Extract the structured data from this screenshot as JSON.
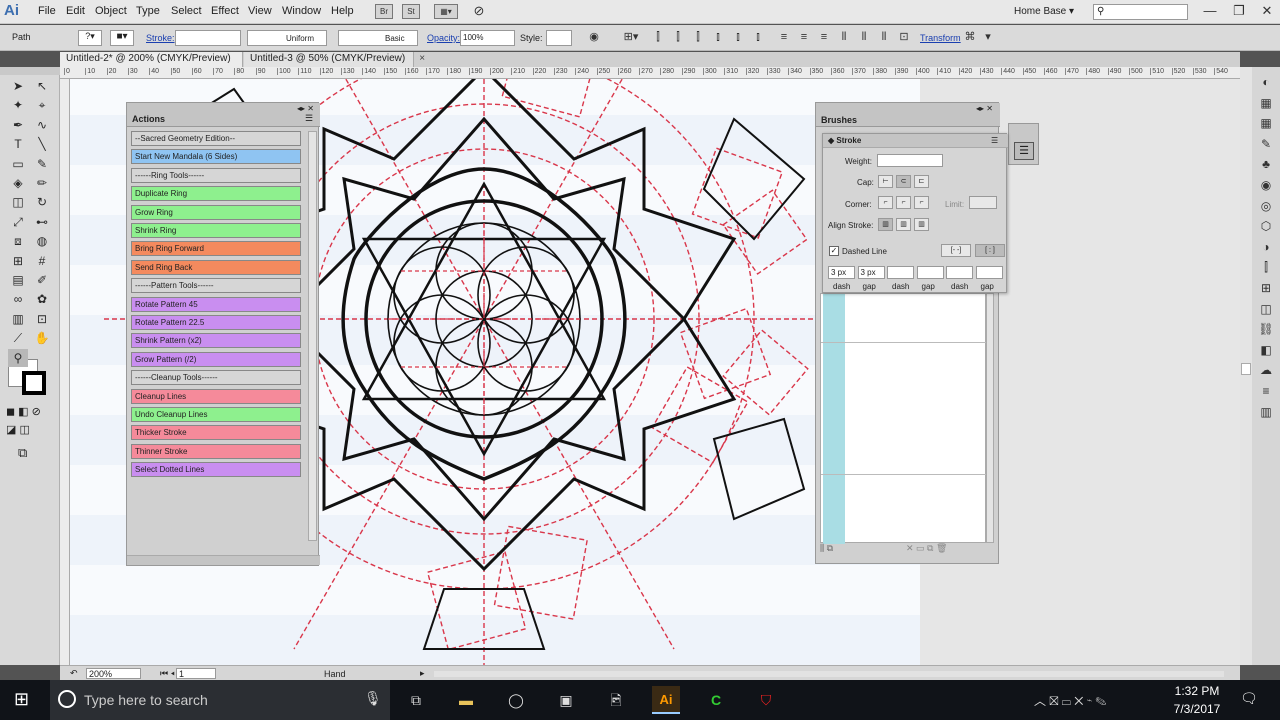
{
  "app": {
    "logo": "Ai",
    "workspace": "Home Base",
    "search_placeholder": ""
  },
  "menu": [
    "File",
    "Edit",
    "Object",
    "Type",
    "Select",
    "Effect",
    "View",
    "Window",
    "Help"
  ],
  "control": {
    "selection": "Path",
    "stroke_label": "Stroke:",
    "profile": "Uniform",
    "brush": "Basic",
    "opacity_label": "Opacity:",
    "opacity": "100%",
    "style_label": "Style:",
    "transform": "Transform"
  },
  "tabs": [
    {
      "label": "Untitled-2* @ 200% (CMYK/Preview)",
      "close": "×"
    },
    {
      "label": "Untitled-3 @ 50% (CMYK/Preview)",
      "close": "×"
    }
  ],
  "ruler_ticks": [
    "0",
    "10",
    "20",
    "30",
    "40",
    "50",
    "60",
    "70",
    "80",
    "90",
    "100",
    "110",
    "120",
    "130",
    "140",
    "150",
    "160",
    "170",
    "180",
    "190",
    "200",
    "210",
    "220",
    "230",
    "240",
    "250",
    "260",
    "270",
    "280",
    "290",
    "300",
    "310",
    "320",
    "330",
    "340",
    "350",
    "360",
    "370",
    "380",
    "390",
    "400",
    "410",
    "420",
    "430",
    "440",
    "450",
    "460",
    "470",
    "480",
    "490",
    "500",
    "510",
    "520",
    "530",
    "540"
  ],
  "actions_panel": {
    "title": "Actions",
    "items": [
      {
        "label": "--Sacred Geometry Edition--",
        "color": "#d6d6d6"
      },
      {
        "label": "Start New Mandala (6 Sides)",
        "color": "#8fc4f2"
      },
      {
        "label": "------Ring Tools------",
        "color": "#d6d6d6"
      },
      {
        "label": "Duplicate Ring",
        "color": "#8ef08e"
      },
      {
        "label": "Grow Ring",
        "color": "#8ef08e"
      },
      {
        "label": "Shrink Ring",
        "color": "#8ef08e"
      },
      {
        "label": "Bring Ring Forward",
        "color": "#f48a5e"
      },
      {
        "label": "Send Ring Back",
        "color": "#f48a5e"
      },
      {
        "label": "------Pattern Tools------",
        "color": "#d6d6d6"
      },
      {
        "label": "Rotate Pattern 45",
        "color": "#c98ef0"
      },
      {
        "label": "Rotate Pattern 22.5",
        "color": "#c98ef0"
      },
      {
        "label": "Shrink Pattern (x2)",
        "color": "#c98ef0"
      },
      {
        "label": "Grow Pattern (/2)",
        "color": "#c98ef0"
      },
      {
        "label": "------Cleanup Tools------",
        "color": "#d6d6d6"
      },
      {
        "label": "Cleanup Lines",
        "color": "#f58a9a"
      },
      {
        "label": "Undo Cleanup Lines",
        "color": "#8ef08e"
      },
      {
        "label": "Thicker Stroke",
        "color": "#f58a9a"
      },
      {
        "label": "Thinner Stroke",
        "color": "#f58a9a"
      },
      {
        "label": "Select Dotted Lines",
        "color": "#c98ef0"
      }
    ]
  },
  "brushes_panel": {
    "title": "Brushes"
  },
  "stroke_panel": {
    "title": "Stroke",
    "weight_label": "Weight:",
    "cap_label": "Cap:",
    "corner_label": "Corner:",
    "limit_label": "Limit:",
    "align_label": "Align Stroke:",
    "dashed_label": "Dashed Line",
    "dashed_checked": true,
    "dash_values": [
      "3 px",
      "3 px",
      "",
      "",
      "",
      ""
    ],
    "dash_labels": [
      "dash",
      "gap",
      "dash",
      "gap",
      "dash",
      "gap"
    ]
  },
  "status": {
    "zoom": "200%",
    "artboard": "1",
    "tool": "Hand"
  },
  "taskbar": {
    "search_placeholder": "Type here to search",
    "time": "1:32 PM",
    "date": "7/3/2017"
  },
  "colors": {
    "accent": "#1a3fb0",
    "guide_red": "#d9364a"
  }
}
